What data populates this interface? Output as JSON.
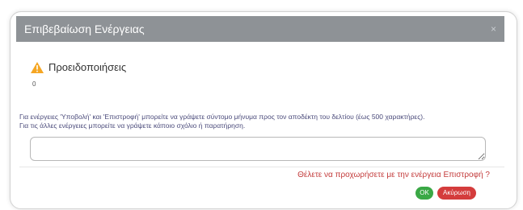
{
  "dialog": {
    "title": "Επιβεβαίωση Ενέργειας",
    "close": "×"
  },
  "warnings": {
    "title": "Προειδοποιήσεις",
    "count": "0",
    "icon": "warning-triangle-icon",
    "icon_color": "#f5a623"
  },
  "help": {
    "line1": "Για ενέργειες 'Υποβολή' και 'Επιστροφή' μπορείτε να γράψετε σύντομο μήνυμα προς τον αποδέκτη του δελτίου (έως 500 χαρακτήρες).",
    "line2": "Για τις άλλες ενέργειες μπορείτε να γράψετε κάποιο σχόλιο ή παρατήρηση."
  },
  "message": {
    "value": ""
  },
  "confirm": {
    "question": "Θέλετε να προχωρήσετε με την ενέργεια Επιστροφή ?",
    "ok_label": "ΟΚ",
    "cancel_label": "Ακύρωση"
  },
  "colors": {
    "titlebar": "#8e9296",
    "question": "#c33b3b",
    "ok": "#3aa845",
    "cancel": "#d43c3c"
  }
}
